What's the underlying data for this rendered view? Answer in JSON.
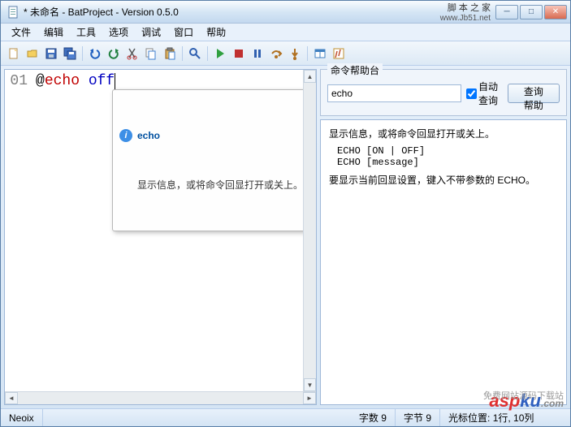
{
  "window": {
    "title": "* 未命名 - BatProject - Version 0.5.0",
    "site_name": "脚 本 之 家",
    "site_url": "www.Jb51.net"
  },
  "menu": {
    "file": "文件",
    "edit": "编辑",
    "tools": "工具",
    "options": "选项",
    "debug": "调试",
    "window": "窗口",
    "help": "帮助"
  },
  "toolbar": {
    "icons": [
      "new",
      "open",
      "save",
      "saveall",
      "undo",
      "redo",
      "cut",
      "copy",
      "paste",
      "find",
      "run",
      "stop",
      "pause",
      "stepover",
      "stepin",
      "togglepane",
      "help"
    ]
  },
  "editor": {
    "line_number": "01",
    "code_at": "@",
    "code_keyword": "echo",
    "code_arg": " off"
  },
  "tooltip": {
    "title": "echo",
    "body": "显示信息，或将命令回显打开或关上。"
  },
  "help_panel": {
    "legend": "命令帮助台",
    "search_value": "echo",
    "auto_label": "自动查询",
    "query_button": "查询帮助",
    "line1": "显示信息，或将命令回显打开或关上。",
    "mono1": "ECHO [ON | OFF]",
    "mono2": "ECHO [message]",
    "line2": "要显示当前回显设置，键入不带参数的 ECHO。"
  },
  "status": {
    "author": "Neoix",
    "chars_label": "字数",
    "chars_value": "9",
    "bytes_label": "字节",
    "bytes_value": "9",
    "cursor_label": "光标位置:",
    "cursor_value": "1行, 10列"
  },
  "watermark": {
    "part1": "asp",
    "part2": "ku",
    "suffix": ".com",
    "dim": "免费网站源码下载站"
  }
}
